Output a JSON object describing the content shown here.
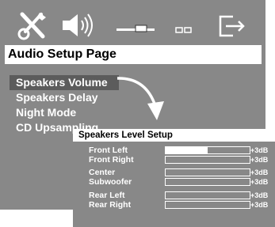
{
  "header": {
    "title": "Audio Setup Page"
  },
  "toolbar": {
    "icons": [
      "tools-icon",
      "speaker-icon",
      "audio-bar-icon",
      "audio-bar-small-icon",
      "exit-icon"
    ]
  },
  "menu": {
    "items": [
      {
        "label": "Speakers Volume",
        "selected": true
      },
      {
        "label": "Speakers Delay",
        "selected": false
      },
      {
        "label": "Night Mode",
        "selected": false
      },
      {
        "label": "CD Upsampling",
        "selected": false
      }
    ]
  },
  "panel": {
    "title": "Speakers Level Setup",
    "rows": [
      {
        "label": "Front Left",
        "value": "+3dB",
        "level": 0.5
      },
      {
        "label": "Front Right",
        "value": "+3dB",
        "level": 0
      },
      {
        "label": "Center",
        "value": "+3dB",
        "level": 0
      },
      {
        "label": "Subwoofer",
        "value": "+3dB",
        "level": 0
      },
      {
        "label": "Rear Left",
        "value": "+3dB",
        "level": 0
      },
      {
        "label": "Rear Right",
        "value": "+3dB",
        "level": 0
      }
    ]
  },
  "colors": {
    "background": "#888888",
    "highlight": "#5c5c5c",
    "text": "#ffffff"
  }
}
